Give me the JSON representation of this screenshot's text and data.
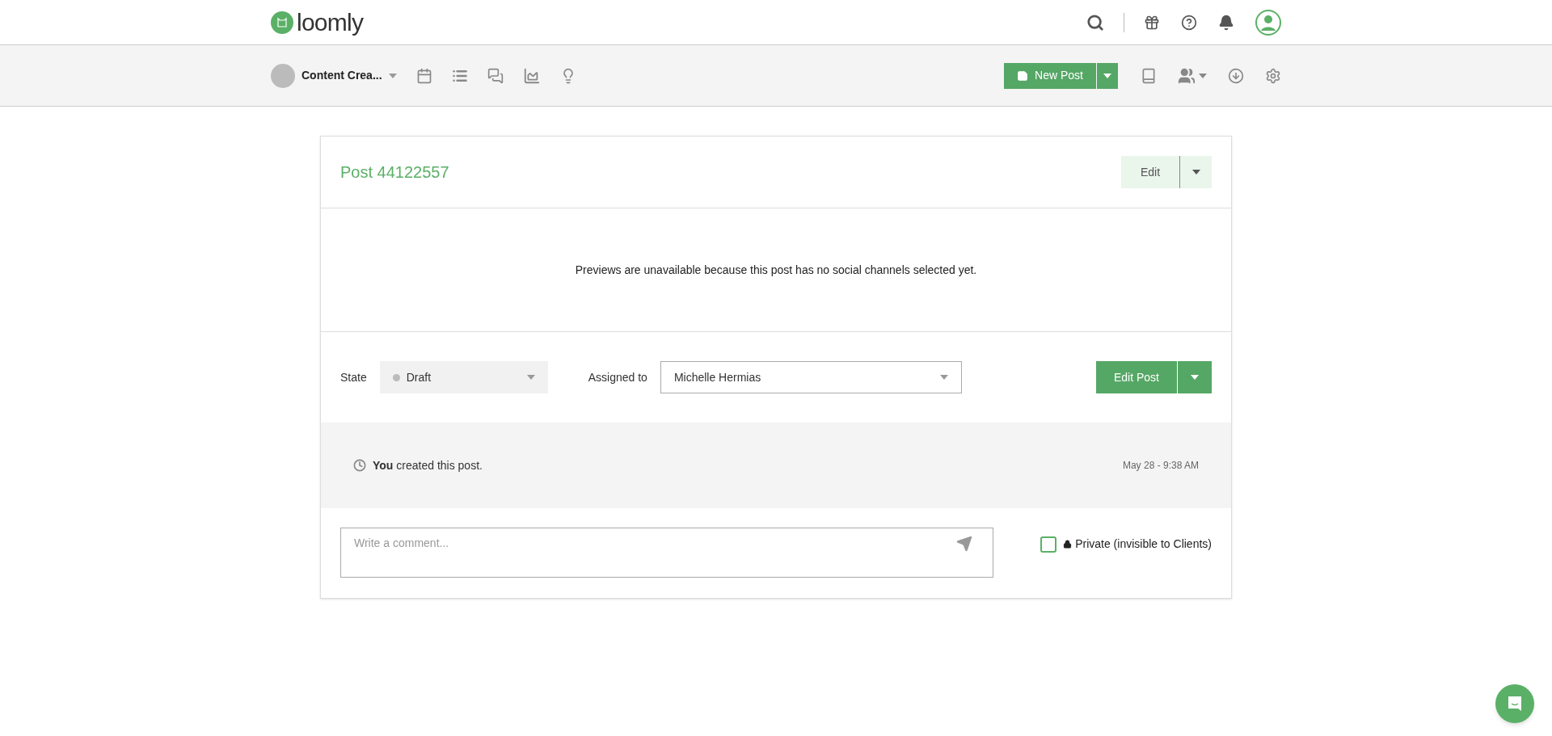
{
  "header": {
    "logo": "loomly"
  },
  "toolbar": {
    "workspace": "Content Crea...",
    "new_post_button": "New Post"
  },
  "post": {
    "title": "Post 44122557",
    "edit_button": "Edit",
    "preview_message": "Previews are unavailable because this post has no social channels selected yet.",
    "state": {
      "label": "State",
      "value": "Draft"
    },
    "assigned": {
      "label": "Assigned to",
      "value": "Michelle Hermias"
    },
    "edit_post_button": "Edit Post",
    "activity": [
      {
        "text": "**You** created this post.",
        "time": "May 28 - 9:38 AM"
      }
    ],
    "comment": {
      "placeholder": "Write a comment..."
    },
    "private": {
      "label": "Private (invisible to Clients)",
      "checked": false
    }
  }
}
